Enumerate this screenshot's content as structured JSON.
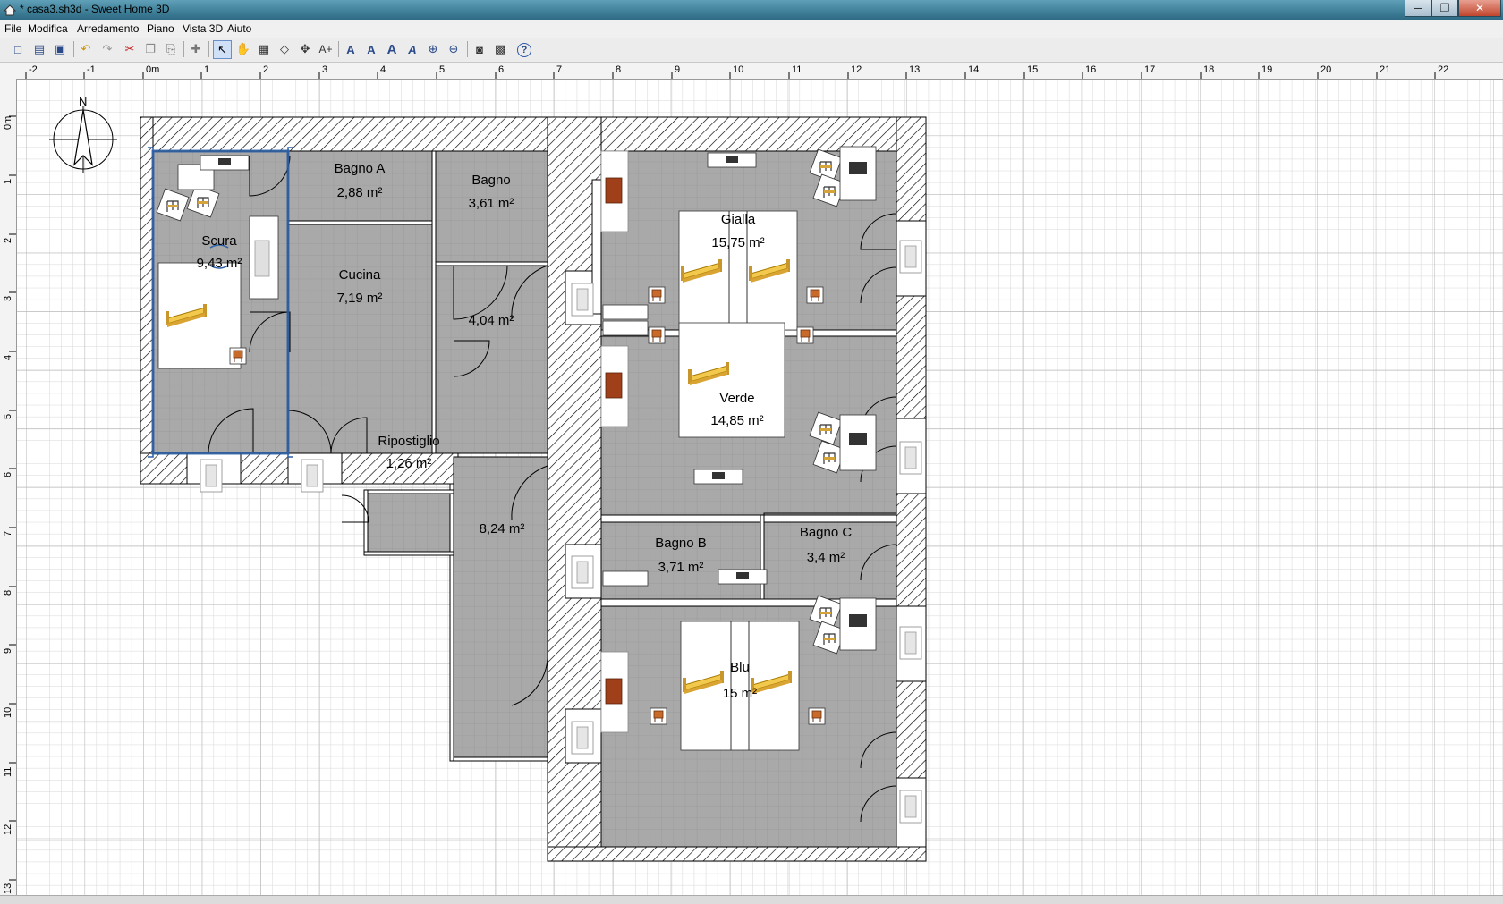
{
  "window": {
    "title": "* casa3.sh3d - Sweet Home 3D",
    "minimize_glyph": "─",
    "maximize_glyph": "❒",
    "close_glyph": "✕"
  },
  "menu": {
    "items": [
      "File",
      "Modifica",
      "Arredamento",
      "Piano",
      "Vista 3D",
      "Aiuto"
    ]
  },
  "toolbar": {
    "buttons": [
      {
        "name": "new-home-icon",
        "glyph": "□"
      },
      {
        "name": "open-icon",
        "glyph": "▤"
      },
      {
        "name": "save-icon",
        "glyph": "▣"
      },
      {
        "name": "undo-icon",
        "glyph": "↶"
      },
      {
        "name": "redo-icon",
        "glyph": "↷"
      },
      {
        "name": "cut-icon",
        "glyph": "✂"
      },
      {
        "name": "copy-icon",
        "glyph": "❐"
      },
      {
        "name": "paste-icon",
        "glyph": "⎘"
      },
      {
        "name": "add-furniture-icon",
        "glyph": "✚"
      },
      {
        "name": "select-mode-icon",
        "glyph": "↖"
      },
      {
        "name": "pan-mode-icon",
        "glyph": "✋"
      },
      {
        "name": "create-walls-icon",
        "glyph": "▦"
      },
      {
        "name": "create-rooms-icon",
        "glyph": "◇"
      },
      {
        "name": "create-dimensions-icon",
        "glyph": "✥"
      },
      {
        "name": "add-text-icon",
        "glyph": "A+"
      },
      {
        "name": "modify-text-style-icon",
        "glyph": "A"
      },
      {
        "name": "increase-text-size-icon",
        "glyph": "A"
      },
      {
        "name": "decrease-text-size-icon",
        "glyph": "A"
      },
      {
        "name": "italic-text-icon",
        "glyph": "A"
      },
      {
        "name": "zoom-in-icon",
        "glyph": "⊕"
      },
      {
        "name": "zoom-out-icon",
        "glyph": "⊖"
      },
      {
        "name": "create-photo-icon",
        "glyph": "◙"
      },
      {
        "name": "create-video-icon",
        "glyph": "▩"
      },
      {
        "name": "help-icon",
        "glyph": "?"
      }
    ]
  },
  "rulers": {
    "horizontal": [
      "-2",
      "-1",
      "0m",
      "1",
      "2",
      "3",
      "4",
      "5",
      "6",
      "7",
      "8",
      "9",
      "10",
      "11",
      "12",
      "13",
      "14",
      "15",
      "16",
      "17",
      "18",
      "19",
      "20",
      "21",
      "22"
    ],
    "vertical": [
      "0m",
      "1",
      "2",
      "3",
      "4",
      "5",
      "6",
      "7",
      "8",
      "9",
      "10",
      "11",
      "12",
      "13"
    ]
  },
  "compass": {
    "label": "N"
  },
  "rooms": [
    {
      "name": "Scura",
      "area": "9,43 m²"
    },
    {
      "name": "Bagno A",
      "area": "2,88 m²"
    },
    {
      "name": "Bagno",
      "area": "3,61 m²"
    },
    {
      "name": "Cucina",
      "area": "7,19 m²"
    },
    {
      "name": "",
      "area": "4,04 m²"
    },
    {
      "name": "Gialla",
      "area": "15,75 m²"
    },
    {
      "name": "Verde",
      "area": "14,85 m²"
    },
    {
      "name": "Ripostiglio",
      "area": "1,26 m²"
    },
    {
      "name": "",
      "area": "8,24 m²"
    },
    {
      "name": "Bagno B",
      "area": "3,71 m²"
    },
    {
      "name": "Bagno C",
      "area": "3,4 m²"
    },
    {
      "name": "Blu",
      "area": "15 m²"
    }
  ],
  "colors": {
    "floor": "#a9a9a9",
    "wall_fill": "#ffffff",
    "wall_stroke": "#000000",
    "grid": "#d6d6d6",
    "selection": "#2b5fa8",
    "bed": "#e8b636"
  }
}
